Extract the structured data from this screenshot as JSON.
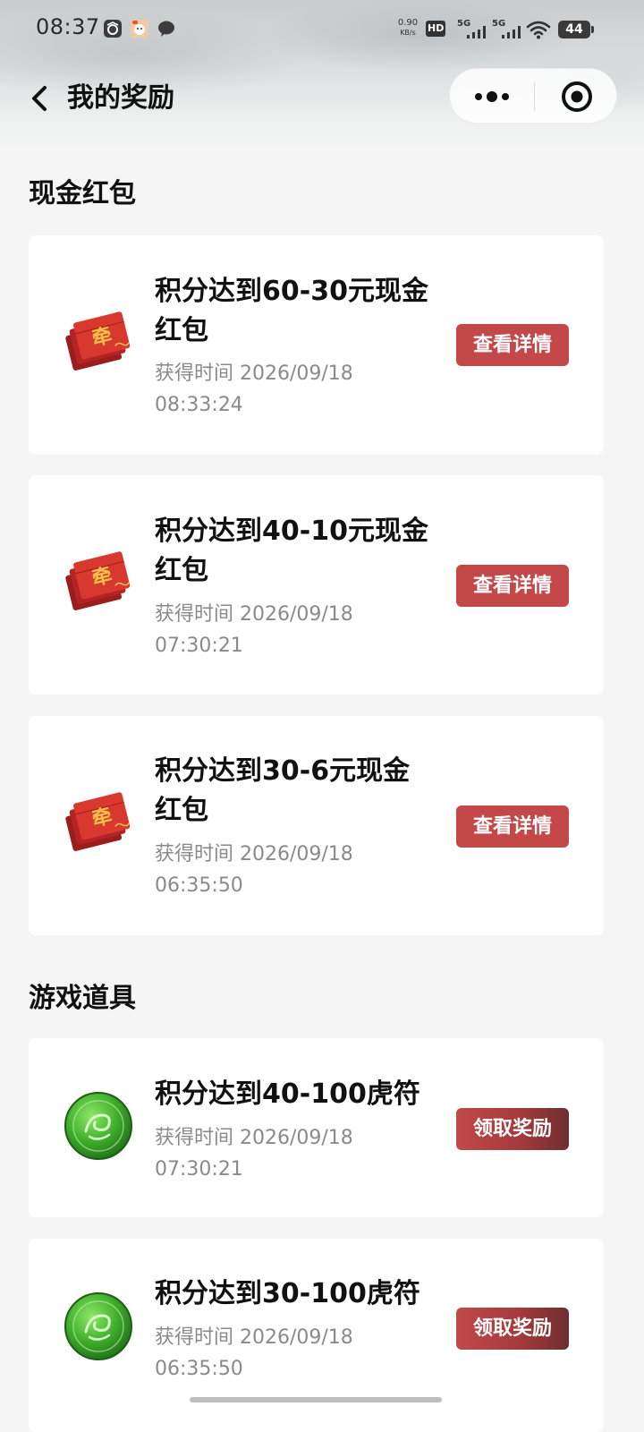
{
  "status_bar": {
    "time": "08:37",
    "net_speed_value": "0.90",
    "net_speed_unit": "KB/s",
    "hd_label": "HD",
    "sim1_label": "5G",
    "sim2_label": "5G",
    "battery": "44",
    "icons": [
      "app-notification-icon",
      "cartoon-app-icon",
      "chat-bubble-icon",
      "wifi-icon",
      "signal-icon"
    ]
  },
  "nav": {
    "title": "我的奖励",
    "back_icon": "chevron-left-icon",
    "more_icon": "more-dots-icon",
    "close_icon": "target-circle-icon"
  },
  "sections": [
    {
      "title": "现金红包",
      "items": [
        {
          "title": "积分达到60-30元现金红包",
          "time_label": "获得时间 2026/09/18",
          "time_clock": "08:33:24",
          "button": "查看详情",
          "icon": "red-envelope-icon"
        },
        {
          "title": "积分达到40-10元现金红包",
          "time_label": "获得时间 2026/09/18",
          "time_clock": "07:30:21",
          "button": "查看详情",
          "icon": "red-envelope-icon"
        },
        {
          "title": "积分达到30-6元现金红包",
          "time_label": "获得时间 2026/09/18",
          "time_clock": "06:35:50",
          "button": "查看详情",
          "icon": "red-envelope-icon"
        }
      ]
    },
    {
      "title": "游戏道具",
      "items": [
        {
          "title": "积分达到40-100虎符",
          "time_label": "获得时间 2026/09/18",
          "time_clock": "07:30:21",
          "button": "领取奖励",
          "icon": "jade-tiger-token-icon"
        },
        {
          "title": "积分达到30-100虎符",
          "time_label": "获得时间 2026/09/18",
          "time_clock": "06:35:50",
          "button": "领取奖励",
          "icon": "jade-tiger-token-icon"
        }
      ]
    }
  ],
  "colors": {
    "detail_button": "#c44848",
    "claim_button": "#a63a3c",
    "page_background": "#f5f5f5",
    "time_text": "#8a8a8a"
  }
}
